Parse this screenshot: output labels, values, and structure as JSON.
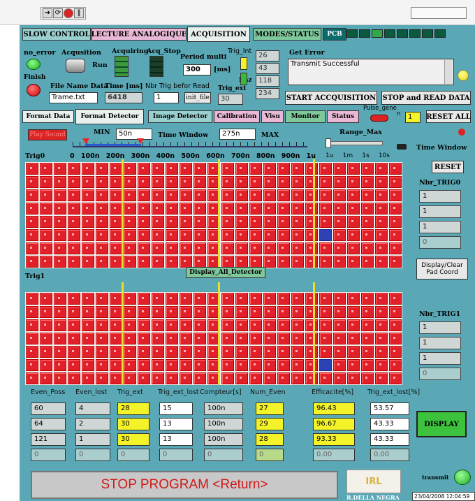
{
  "toolbar": {
    "icons": [
      "arrow-icon",
      "run-continuous-icon",
      "stop-icon",
      "pause-icon"
    ]
  },
  "tabs_top": [
    "SLOW CONTROL",
    "LECTURE ANALOGIQUE",
    "ACQUISITION",
    "MODES/STATUS",
    "PCB"
  ],
  "status": {
    "no_error": "no_error",
    "finish": "Finish",
    "acquisition": "Acqusition",
    "run": "Run",
    "acquiring": "Acquiring",
    "acq_stop": "Acq_Stop",
    "period_multi": "Period multi",
    "period_value": "300",
    "period_unit": "[ms]",
    "trig_int": "Trig_Int",
    "raz": "Raz",
    "trig_ext": "Trig_ext",
    "file_name_label": "File Name Data",
    "file_name_value": "Trame.txt",
    "time_label": "Time [ms]",
    "time_value": "6418",
    "nbr_trig_label": "Nbr Trig befor Read",
    "nbr_trig_value": "1",
    "init_file": "init_file",
    "counter_values": [
      "26",
      "43",
      "118",
      "234"
    ],
    "raz_value": "30",
    "get_error_label": "Get Error",
    "get_error_text": "Transmit Successful"
  },
  "buttons": {
    "start": "START ACCQUISITION",
    "stop_read": "STOP and READ DATA",
    "reset_all": "RESET ALL",
    "reset": "RESET",
    "display_all": "Display_All_Detector",
    "display_clear": "Display/Clear Pad Coord",
    "display": "DISPLAY",
    "play_sound": "Play Sound",
    "stop_program": "STOP PROGRAM <Return>",
    "transmit": "transmit"
  },
  "tabs_sub": [
    "Format Data",
    "Format Detector",
    "Image Detector",
    "Calibration",
    "Visu",
    "Monitor",
    "Status"
  ],
  "pulse": {
    "label": "Pulse_gene",
    "n_label": "n",
    "value": "1"
  },
  "time_controls": {
    "min_label": "MIN",
    "min_value": "50n",
    "window_label": "Time Window",
    "window_value": "275n",
    "max_label": "MAX",
    "range_max": "Range_Max",
    "time_window_right": "Time Window",
    "scale_ticks": [
      "0",
      "100n",
      "200n",
      "300n",
      "400n",
      "500n",
      "600n",
      "700n",
      "800n",
      "900n",
      "1u"
    ],
    "range_ticks": [
      "1u",
      "1m",
      "1s",
      "10s"
    ]
  },
  "trig0": {
    "label": "Trig0",
    "nbr_label": "Nbr_TRIG0",
    "values": [
      "1",
      "1",
      "1",
      "0"
    ],
    "blue_cell": {
      "row": 5,
      "col": 21
    }
  },
  "trig1": {
    "label": "Trig1",
    "nbr_label": "Nbr_TRIG1",
    "values": [
      "1",
      "1",
      "1",
      "0"
    ],
    "blue_cell": {
      "row": 5,
      "col": 21
    }
  },
  "table": {
    "headers": [
      "Even_Poss",
      "Even_lost",
      "Trig_ext",
      "Trig_ext_lost",
      "Compteur[s]",
      "Num_Even",
      "Efficacite[%]",
      "Trig_ext_lost[%]"
    ],
    "columns": [
      [
        "60",
        "64",
        "121",
        "0"
      ],
      [
        "4",
        "2",
        "1",
        "0"
      ],
      [
        "28",
        "30",
        "30",
        "0"
      ],
      [
        "15",
        "13",
        "13",
        "0"
      ],
      [
        "100n",
        "100n",
        "100n",
        "0"
      ],
      [
        "27",
        "29",
        "28",
        "0"
      ],
      [
        "96.43",
        "96.67",
        "93.33",
        "0.00"
      ],
      [
        "53.57",
        "43.33",
        "43.33",
        "0.00"
      ]
    ]
  },
  "footer": {
    "logo_text": "R.DELLA NEGRA",
    "timestamp": "23/04/2008 12:04:59"
  },
  "colors": {
    "panel": "#5aa8b6",
    "pad": "#e2202a",
    "hit": "#2e42b8",
    "marker": "#e6e030"
  }
}
